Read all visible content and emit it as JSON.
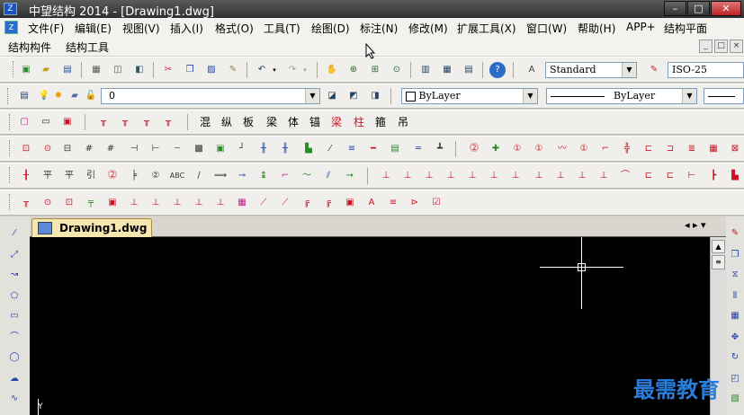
{
  "window": {
    "title": "中望结构 2014 - [Drawing1.dwg]",
    "app_icon_text": "Z",
    "controls": {
      "minimize": "–",
      "maximize": "□",
      "close": "✕"
    }
  },
  "menubar": {
    "items": [
      "文件(F)",
      "编辑(E)",
      "视图(V)",
      "插入(I)",
      "格式(O)",
      "工具(T)",
      "绘图(D)",
      "标注(N)",
      "修改(M)",
      "扩展工具(X)",
      "窗口(W)",
      "帮助(H)",
      "APP+",
      "结构平面"
    ]
  },
  "menubar2": {
    "items": [
      "结构构件",
      "结构工具"
    ],
    "mdi_controls": [
      "_",
      "□",
      "×"
    ]
  },
  "standard_toolbar": {
    "text_style": "Standard",
    "dim_style": "ISO-25",
    "icons": [
      "new-icon",
      "open-icon",
      "save-icon",
      "print-icon",
      "preview-icon",
      "publish-icon",
      "cut-icon",
      "copy-icon",
      "paste-icon",
      "match-prop-icon",
      "undo-icon",
      "redo-icon",
      "pan-icon",
      "zoom-realtime-icon",
      "zoom-window-icon",
      "zoom-prev-icon",
      "properties-icon",
      "design-center-icon",
      "tool-palette-icon",
      "help-icon",
      "text-style-icon",
      "dim-style-icon"
    ]
  },
  "layer_toolbar": {
    "layer_value": "0",
    "color_value": "ByLayer",
    "linetype_value": "ByLayer"
  },
  "struct_toolbar": {
    "chars": [
      "混",
      "纵",
      "板",
      "梁",
      "体",
      "锚",
      "梁",
      "柱",
      "箍",
      "吊"
    ]
  },
  "document": {
    "tab_label": "Drawing1.dwg",
    "axis_label": "Y",
    "nav_arrows": "◂ ▸ ▾"
  },
  "watermark": "最需教育",
  "colors": {
    "canvas": "#000000",
    "accent_red": "#d01818",
    "accent_blue": "#2a7dd8",
    "tab_bg": "#f6e6b0"
  }
}
